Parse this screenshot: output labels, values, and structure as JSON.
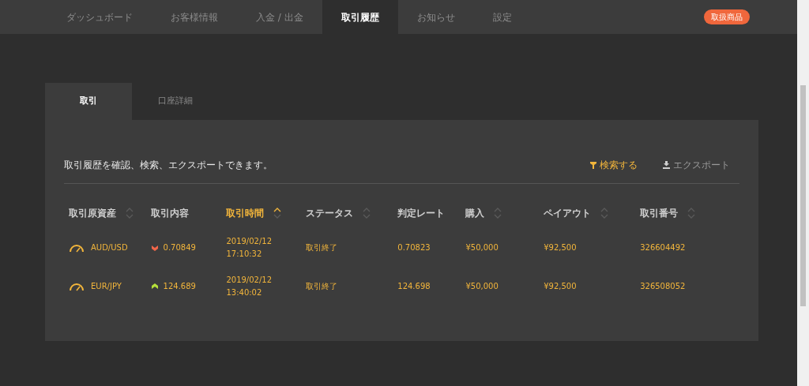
{
  "nav": {
    "items": [
      {
        "label": "ダッシュボード",
        "selected": false
      },
      {
        "label": "お客様情報",
        "selected": false
      },
      {
        "label": "入金 / 出金",
        "selected": false
      },
      {
        "label": "取引履歴",
        "selected": true
      },
      {
        "label": "お知らせ",
        "selected": false
      },
      {
        "label": "設定",
        "selected": false
      }
    ],
    "badge": "取扱商品"
  },
  "tabs": [
    {
      "label": "取引",
      "selected": true
    },
    {
      "label": "口座詳細",
      "selected": false
    }
  ],
  "description": "取引履歴を確認、検索、エクスポートできます。",
  "actions": [
    {
      "label": "検索する",
      "kind": "filter"
    },
    {
      "label": "エクスポート",
      "kind": "export"
    }
  ],
  "table": {
    "columns": [
      {
        "label": "取引原資産",
        "sortable": true,
        "selected": false
      },
      {
        "label": "取引内容",
        "sortable": false,
        "selected": false
      },
      {
        "label": "取引時間",
        "sortable": true,
        "selected": true
      },
      {
        "label": "ステータス",
        "sortable": true,
        "selected": false
      },
      {
        "label": "判定レート",
        "sortable": false,
        "selected": false
      },
      {
        "label": "購入",
        "sortable": true,
        "selected": false
      },
      {
        "label": "ペイアウト",
        "sortable": true,
        "selected": false
      },
      {
        "label": "取引番号",
        "sortable": true,
        "selected": false
      }
    ],
    "rows": [
      {
        "asset": "AUD/USD",
        "kind": "down",
        "rate": "0.70849",
        "date": "2019/02/12",
        "time": "17:10:32",
        "status": "取引終了",
        "judge_rate": "0.70823",
        "purchase": "¥50,000",
        "payout": "¥92,500",
        "number": "326604492"
      },
      {
        "asset": "EUR/JPY",
        "kind": "up",
        "rate": "124.689",
        "date": "2019/02/12",
        "time": "13:40:02",
        "status": "取引終了",
        "judge_rate": "124.698",
        "purchase": "¥50,000",
        "payout": "¥92,500",
        "number": "326508052"
      }
    ]
  }
}
